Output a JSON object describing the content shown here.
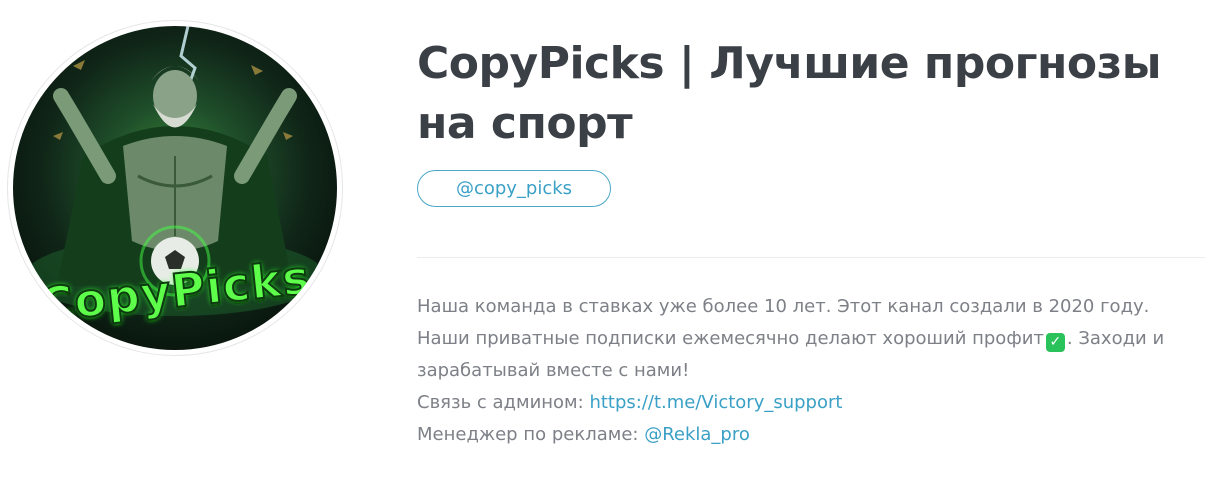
{
  "avatar": {
    "logo_text": "CopyPicks",
    "accent_color": "#5dff4a"
  },
  "channel": {
    "title": "CopyPicks | Лучшие прогнозы на спорт",
    "username": "@copy_picks"
  },
  "description": {
    "line1": "Наша команда в ставках уже более 10 лет. Этот канал создали в 2020 году.",
    "line2_before": "Наши приватные подписки ежемесячно делают хороший профит",
    "line2_emoji": "✓",
    "line2_after": ". Заходи и",
    "line3": "зарабатывай вместе с нами!",
    "admin_label": "Связь с админом: ",
    "admin_link": "https://t.me/Victory_support",
    "ads_label": "Менеджер по рекламе: ",
    "ads_link": "@Rekla_pro"
  },
  "colors": {
    "title": "#3b3f46",
    "text": "#7d8087",
    "link": "#3aa0c6"
  }
}
